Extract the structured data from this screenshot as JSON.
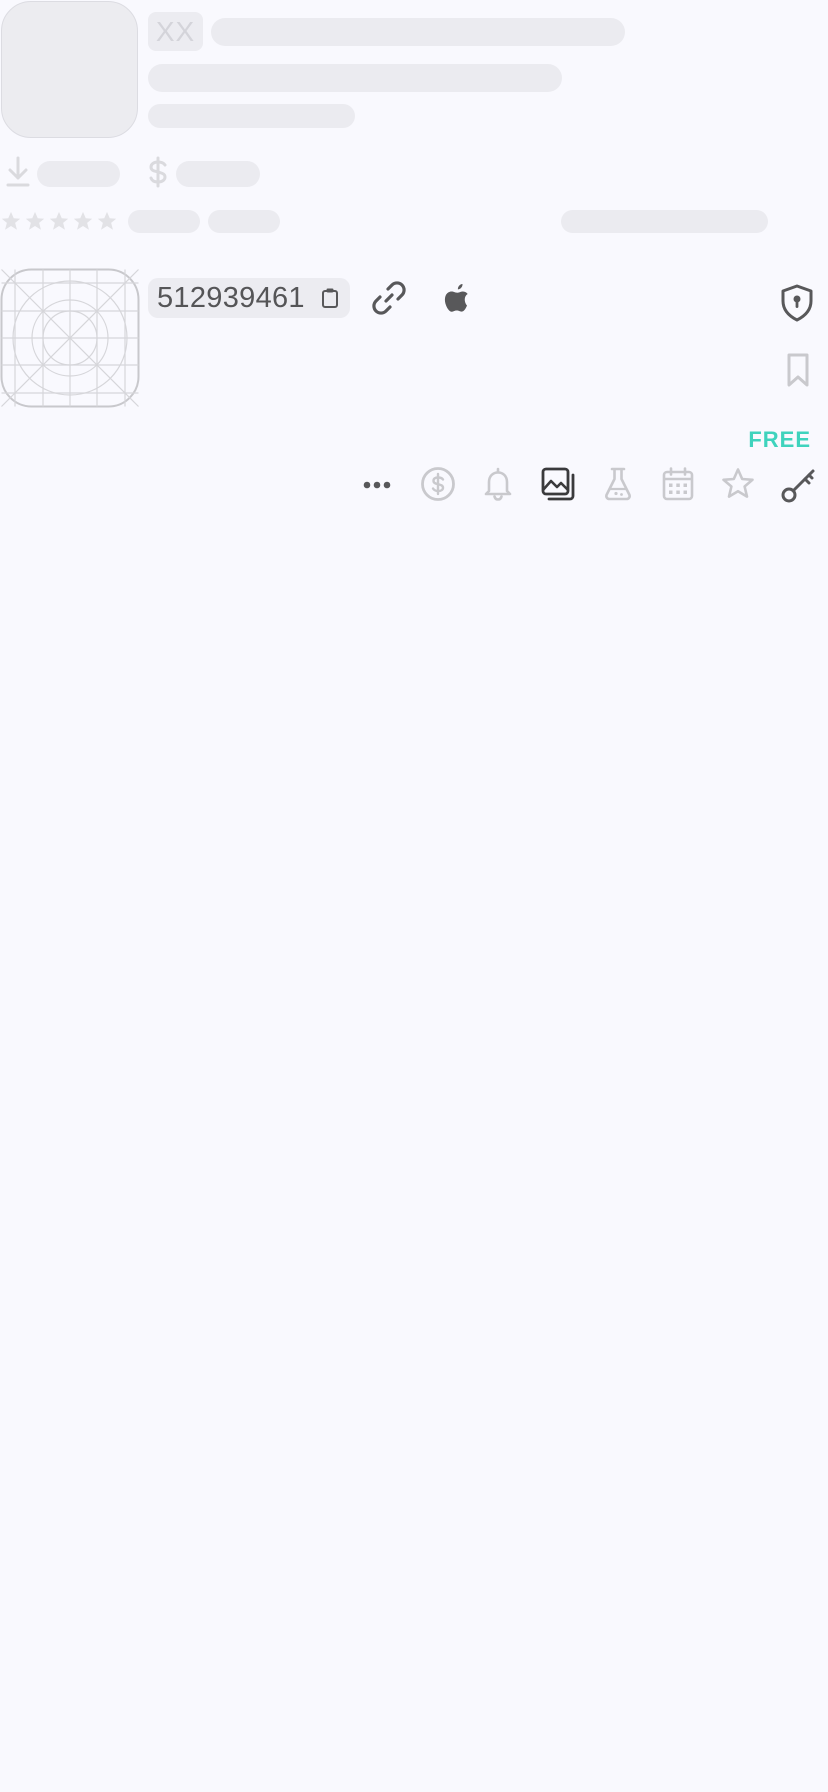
{
  "header": {
    "country_code": "XX"
  },
  "app": {
    "id": "512939461",
    "price_label": "FREE"
  },
  "icons": {
    "download": "download-icon",
    "price": "dollar-icon",
    "copy": "clipboard-icon",
    "link": "link-icon",
    "platform": "apple-icon",
    "privacy": "shield-lock-icon",
    "bookmark": "bookmark-icon",
    "more": "more-icon",
    "in_app_purchases": "dollar-circle-icon",
    "notifications": "bell-icon",
    "screenshots": "images-icon",
    "beta": "flask-icon",
    "calendar": "calendar-icon",
    "favorite": "star-icon",
    "keys": "key-icon"
  },
  "colors": {
    "background": "#f9f9fe",
    "skeleton": "#ebebf0",
    "accent_free": "#3fd3bd",
    "icon_active": "#58585a",
    "icon_inactive": "#c9c9cd"
  }
}
